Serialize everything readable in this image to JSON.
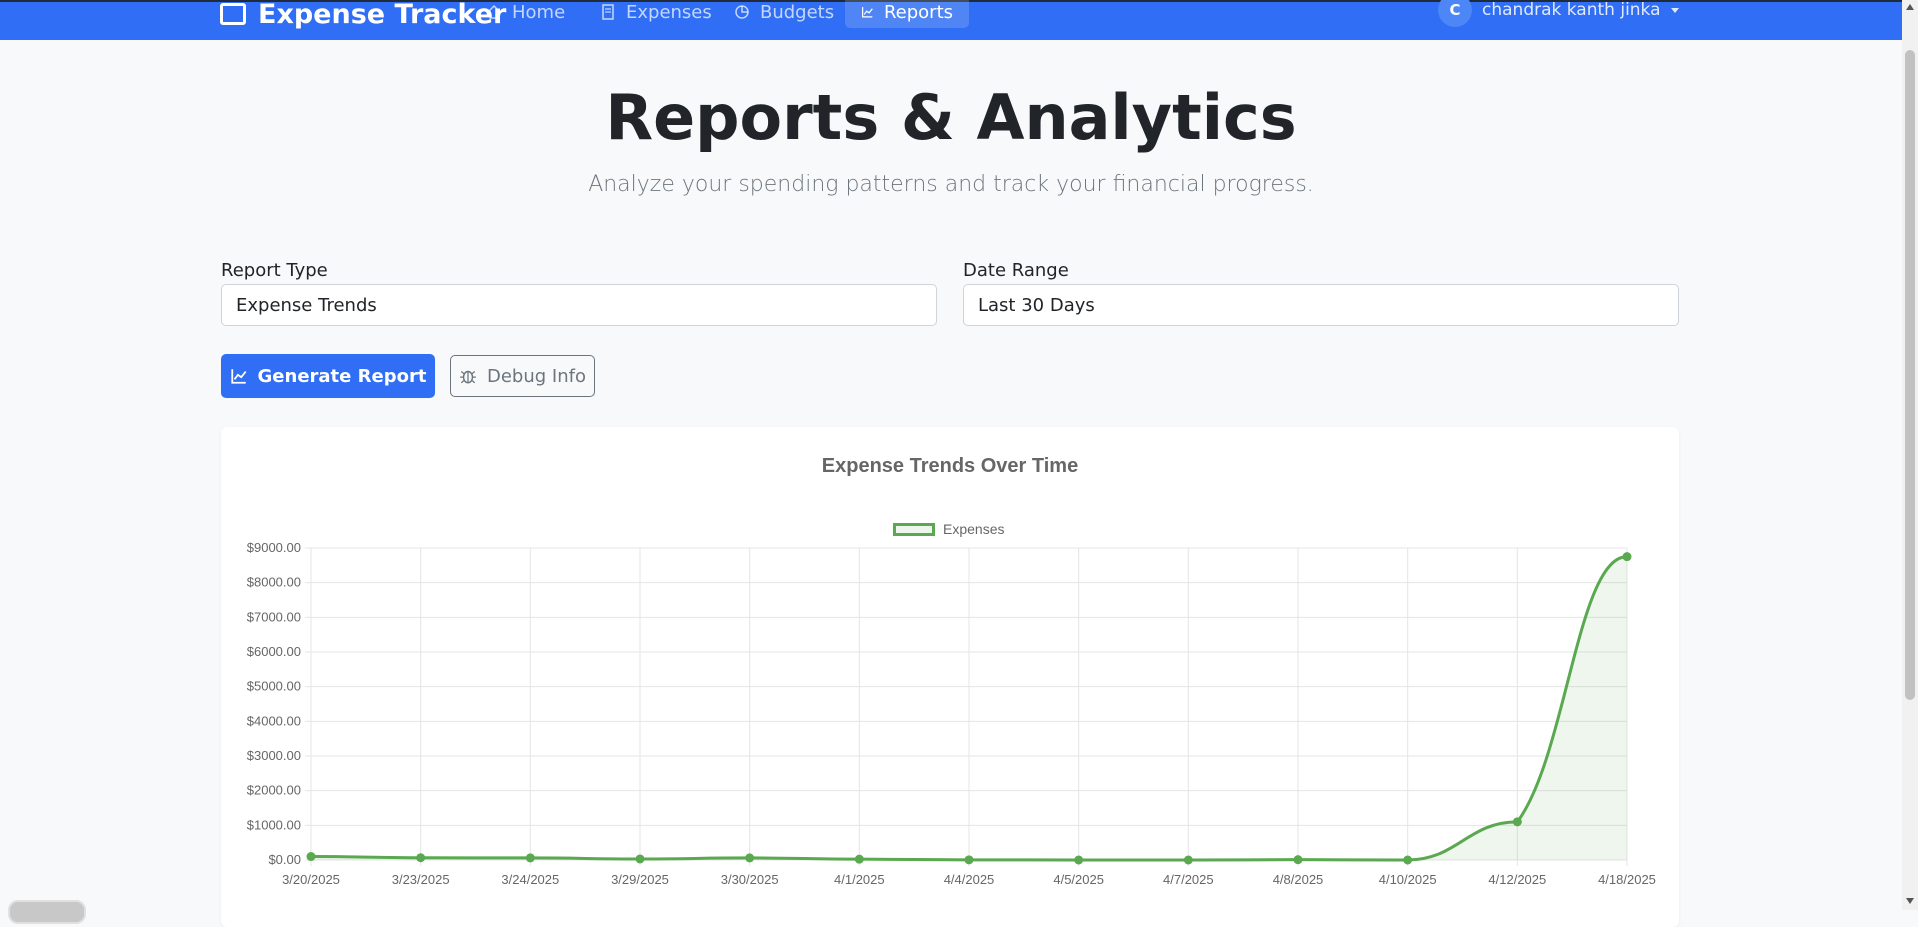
{
  "nav": {
    "brand": "Expense Tracker",
    "items": [
      {
        "label": "Home",
        "icon": "home-icon"
      },
      {
        "label": "Expenses",
        "icon": "receipt-icon"
      },
      {
        "label": "Budgets",
        "icon": "pie-chart-icon"
      },
      {
        "label": "Reports",
        "icon": "chart-line-icon",
        "active": true
      }
    ],
    "user": {
      "initial": "C",
      "name": "chandrak kanth jinka"
    }
  },
  "page": {
    "title": "Reports & Analytics",
    "subtitle": "Analyze your spending patterns and track your financial progress."
  },
  "filters": {
    "report_type_label": "Report Type",
    "report_type_value": "Expense Trends",
    "date_range_label": "Date Range",
    "date_range_value": "Last 30 Days"
  },
  "actions": {
    "generate_label": "Generate Report",
    "debug_label": "Debug Info"
  },
  "colors": {
    "primary": "#2f6ef5",
    "series": "#5aa84f"
  },
  "chart_data": {
    "type": "line",
    "title": "Expense Trends Over Time",
    "categories": [
      "3/20/2025",
      "3/23/2025",
      "3/24/2025",
      "3/29/2025",
      "3/30/2025",
      "4/1/2025",
      "4/4/2025",
      "4/5/2025",
      "4/7/2025",
      "4/8/2025",
      "4/10/2025",
      "4/12/2025",
      "4/18/2025"
    ],
    "series": [
      {
        "name": "Expenses",
        "values": [
          100,
          65,
          60,
          30,
          60,
          25,
          5,
          0,
          0,
          10,
          0,
          1100,
          8750
        ]
      }
    ],
    "y_ticks": [
      "$0.00",
      "$1000.00",
      "$2000.00",
      "$3000.00",
      "$4000.00",
      "$5000.00",
      "$6000.00",
      "$7000.00",
      "$8000.00",
      "$9000.00"
    ],
    "ylim": [
      0,
      9000
    ],
    "grid": true,
    "legend": "top"
  }
}
